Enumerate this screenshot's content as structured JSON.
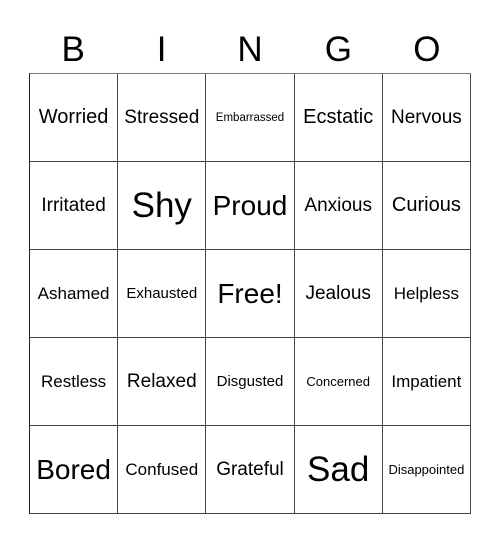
{
  "header": [
    "B",
    "I",
    "N",
    "G",
    "O"
  ],
  "cells": [
    [
      "Worried",
      "Stressed",
      "Embarrassed",
      "Ecstatic",
      "Nervous"
    ],
    [
      "Irritated",
      "Shy",
      "Proud",
      "Anxious",
      "Curious"
    ],
    [
      "Ashamed",
      "Exhausted",
      "Free!",
      "Jealous",
      "Helpless"
    ],
    [
      "Restless",
      "Relaxed",
      "Disgusted",
      "Concerned",
      "Impatient"
    ],
    [
      "Bored",
      "Confused",
      "Grateful",
      "Sad",
      "Disappointed"
    ]
  ]
}
